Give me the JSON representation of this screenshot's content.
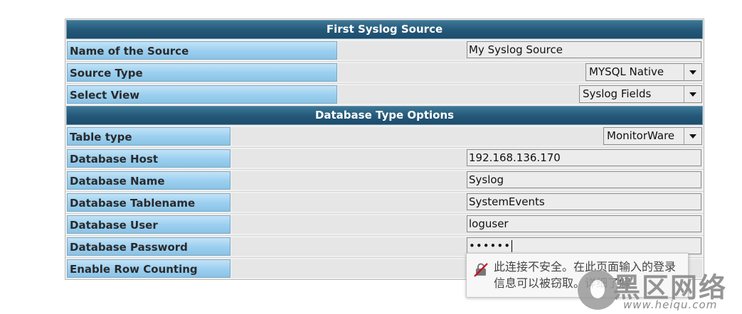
{
  "source": {
    "header": "First Syslog Source",
    "name_label": "Name of the Source",
    "name_value": "My Syslog Source",
    "type_label": "Source Type",
    "type_value": "MYSQL Native",
    "view_label": "Select View",
    "view_value": "Syslog Fields"
  },
  "database": {
    "header": "Database Type Options",
    "table_type_label": "Table type",
    "table_type_value": "MonitorWare",
    "host_label": "Database Host",
    "host_value": "192.168.136.170",
    "name_label": "Database Name",
    "name_value": "Syslog",
    "tablename_label": "Database Tablename",
    "tablename_value": "SystemEvents",
    "user_label": "Database User",
    "user_value": "loguser",
    "password_label": "Database Password",
    "password_mask": "••••••",
    "row_counting_label": "Enable Row Counting"
  },
  "tooltip": {
    "icon": "insecure-lock-icon",
    "text": "此连接不安全。在此页面输入的登录信息可以被窃取。详细了解"
  },
  "watermark": {
    "title": "黑区网络",
    "url": "www.heiqu.com"
  }
}
